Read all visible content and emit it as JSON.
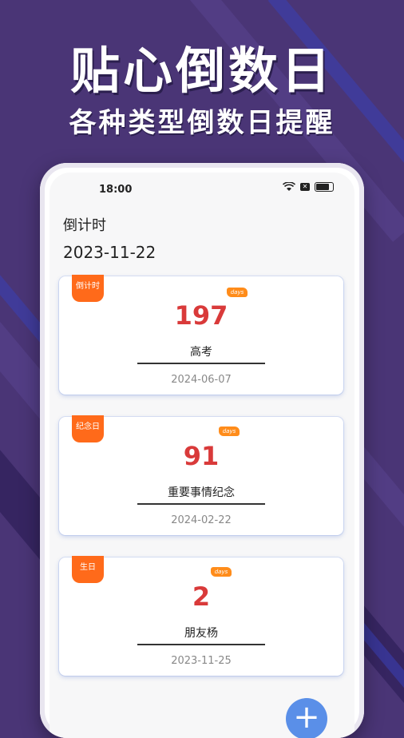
{
  "promo": {
    "headline": "贴心倒数日",
    "subheadline": "各种类型倒数日提醒"
  },
  "status_bar": {
    "time": "18:00",
    "sim_label": "✕"
  },
  "header": {
    "title": "倒计时",
    "today": "2023-11-22"
  },
  "cards": [
    {
      "tag": "倒计时",
      "badge": "days",
      "count": "197",
      "name": "高考",
      "date": "2024-06-07"
    },
    {
      "tag": "纪念日",
      "badge": "days",
      "count": "91",
      "name": "重要事情纪念",
      "date": "2024-02-22"
    },
    {
      "tag": "生日",
      "badge": "days",
      "count": "2",
      "name": "朋友杨",
      "date": "2023-11-25"
    }
  ],
  "fab": {
    "label": "+"
  },
  "colors": {
    "background": "#4a3576",
    "tag": "#ff6a1a",
    "count": "#d93a3a",
    "fab": "#5a8fe8"
  }
}
